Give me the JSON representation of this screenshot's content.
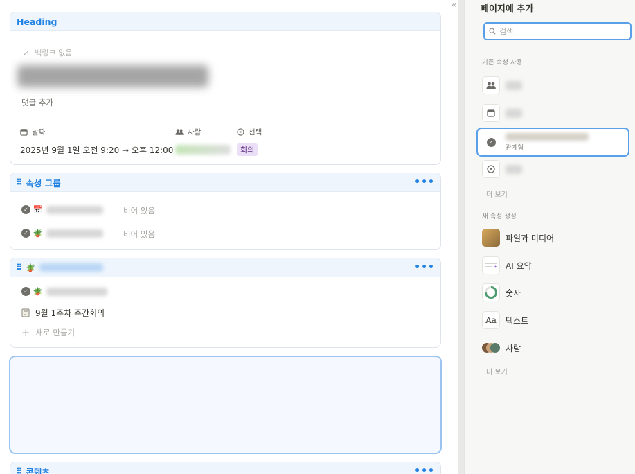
{
  "canvas": {
    "heading_card": {
      "title": "Heading",
      "backlink": "백링크 없음",
      "add_comment": "댓글 추가",
      "properties": [
        {
          "label": "날짜",
          "icon": "calendar-icon",
          "value": "2025년 9월 1일 오전 9:20 → 오후 12:00"
        },
        {
          "label": "사람",
          "icon": "people-icon",
          "value": ""
        },
        {
          "label": "선택",
          "icon": "select-icon",
          "value": "회의"
        }
      ]
    },
    "group_card": {
      "title": "속성 그룹",
      "rows": [
        {
          "emoji": "📅",
          "value": "비어 있음"
        },
        {
          "emoji": "🪴",
          "value": "비어 있음"
        }
      ]
    },
    "relation_card": {
      "emoji": "🪴",
      "page_item": "9월 1주차 주간회의",
      "new_label": "새로 만들기"
    },
    "contents_card": {
      "title": "콘텐츠"
    }
  },
  "panel": {
    "title": "페이지에 추가",
    "search": {
      "placeholder": "검색",
      "value": ""
    },
    "existing_section": "기존 속성 사용",
    "existing_items": [
      {
        "icon": "people-icon",
        "label": ""
      },
      {
        "icon": "calendar-icon",
        "label": ""
      },
      {
        "icon": "check-circle-icon",
        "label": "",
        "sub": "관계형"
      },
      {
        "icon": "select-icon",
        "label": ""
      }
    ],
    "more_1": "더 보기",
    "new_section": "새 속성 생성",
    "new_items": [
      {
        "icon": "media-icon",
        "label": "파일과 미디어"
      },
      {
        "icon": "ai-summary-icon",
        "label": "AI 요약"
      },
      {
        "icon": "number-ring-icon",
        "label": "숫자"
      },
      {
        "icon": "text-icon",
        "icon_text": "Aa",
        "label": "텍스트"
      },
      {
        "icon": "people-avatars-icon",
        "label": "사람"
      }
    ],
    "more_2": "더 보기"
  },
  "colors": {
    "accent": "#2383e2",
    "tag_bg": "#eadff6",
    "panel_bg": "#f7f7f5",
    "header_bg": "#eef5fd"
  }
}
